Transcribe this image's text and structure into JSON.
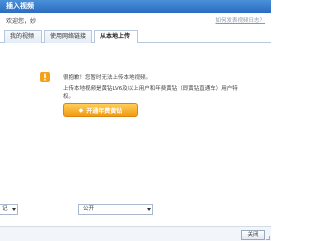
{
  "window": {
    "title": "插入视频"
  },
  "header": {
    "welcome_text": "欢迎您，妙",
    "help_link": "如何发表视频日志？"
  },
  "tabs": [
    {
      "label": "我的视频",
      "active": false
    },
    {
      "label": "使用网络链接",
      "active": false
    },
    {
      "label": "从本地上传",
      "active": true
    }
  ],
  "notice": {
    "line1": "很抱歉！您暂时无法上传本地视频。",
    "line2": "上传本地视频是黄钻LV6及以上用户和年费黄钻（即黄钻直通车）用户特",
    "line3": "权。",
    "button_label": "开通年费黄钻",
    "icon": "warning-icon"
  },
  "footer": {
    "left_select_value": "记",
    "privacy_select_value": "公开"
  },
  "statusbar": {
    "close_label": "关闭"
  },
  "colors": {
    "accent": "#f29b12",
    "title_bar": "#2a6cc0"
  }
}
